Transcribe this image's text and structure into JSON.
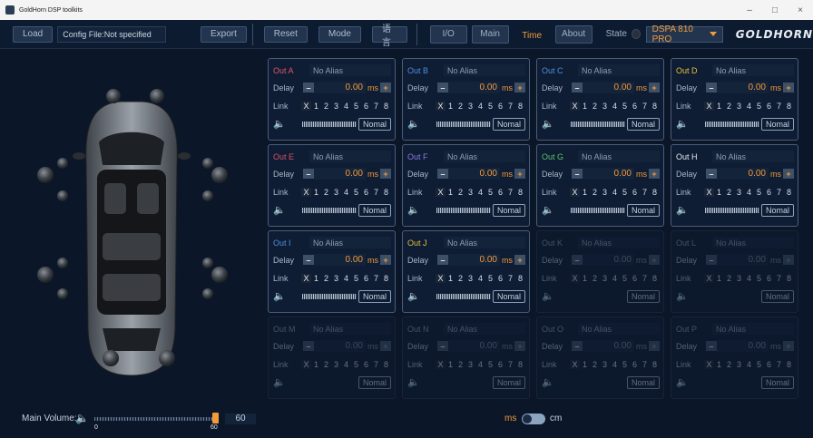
{
  "window": {
    "title": "GoldHorn DSP toolkits",
    "controls": [
      "–",
      "□",
      "×"
    ]
  },
  "toolbar": {
    "load_label": "Load",
    "config_file": "Config File:Not specified",
    "export_label": "Export",
    "reset_label": "Reset",
    "mode_label": "Mode",
    "language_label": "语言",
    "tabs": [
      {
        "label": "I/O"
      },
      {
        "label": "Main"
      },
      {
        "label": "Time",
        "active": true
      },
      {
        "label": "About"
      }
    ],
    "state_label": "State",
    "device_name": "DSPA 810 PRO",
    "logo": "GOLDHORN"
  },
  "channels": [
    {
      "name": "Out A",
      "color": "#e0556e",
      "alias": "No Alias",
      "delay": "0.00",
      "unit": "ms",
      "enabled": true
    },
    {
      "name": "Out B",
      "color": "#4f8fe0",
      "alias": "No Alias",
      "delay": "0.00",
      "unit": "ms",
      "enabled": true
    },
    {
      "name": "Out C",
      "color": "#4f8fe0",
      "alias": "No Alias",
      "delay": "0.00",
      "unit": "ms",
      "enabled": true
    },
    {
      "name": "Out D",
      "color": "#e3c13b",
      "alias": "No Alias",
      "delay": "0.00",
      "unit": "ms",
      "enabled": true
    },
    {
      "name": "Out E",
      "color": "#d6506a",
      "alias": "No Alias",
      "delay": "0.00",
      "unit": "ms",
      "enabled": true
    },
    {
      "name": "Out F",
      "color": "#8a7be0",
      "alias": "No Alias",
      "delay": "0.00",
      "unit": "ms",
      "enabled": true
    },
    {
      "name": "Out G",
      "color": "#58c46a",
      "alias": "No Alias",
      "delay": "0.00",
      "unit": "ms",
      "enabled": true
    },
    {
      "name": "Out H",
      "color": "#e6ecf3",
      "alias": "No Alias",
      "delay": "0.00",
      "unit": "ms",
      "enabled": true
    },
    {
      "name": "Out I",
      "color": "#4f8fe0",
      "alias": "No Alias",
      "delay": "0.00",
      "unit": "ms",
      "enabled": true
    },
    {
      "name": "Out J",
      "color": "#e3c13b",
      "alias": "No Alias",
      "delay": "0.00",
      "unit": "ms",
      "enabled": true
    },
    {
      "name": "Out K",
      "color": "#8a96a8",
      "alias": "No Alias",
      "delay": "0.00",
      "unit": "ms",
      "enabled": false
    },
    {
      "name": "Out L",
      "color": "#8a96a8",
      "alias": "No Alias",
      "delay": "0.00",
      "unit": "ms",
      "enabled": false
    },
    {
      "name": "Out M",
      "color": "#8a96a8",
      "alias": "No Alias",
      "delay": "0.00",
      "unit": "ms",
      "enabled": false
    },
    {
      "name": "Out N",
      "color": "#8a96a8",
      "alias": "No Alias",
      "delay": "0.00",
      "unit": "ms",
      "enabled": false
    },
    {
      "name": "Out O",
      "color": "#8a96a8",
      "alias": "No Alias",
      "delay": "0.00",
      "unit": "ms",
      "enabled": false
    },
    {
      "name": "Out P",
      "color": "#8a96a8",
      "alias": "No Alias",
      "delay": "0.00",
      "unit": "ms",
      "enabled": false
    }
  ],
  "labels": {
    "delay": "Delay",
    "link": "Link",
    "link_x": "X",
    "link_numbers": [
      "1",
      "2",
      "3",
      "4",
      "5",
      "6",
      "7",
      "8"
    ],
    "nomal": "Nomal"
  },
  "footer": {
    "main_volume_label": "Main Volume:",
    "volume_min": "0",
    "volume_max": "60",
    "volume_value": "60",
    "volume_level": 1.0,
    "unit_ms": "ms",
    "unit_cm": "cm"
  },
  "icons": {
    "app": "app-icon",
    "speaker": "speaker-icon",
    "volume": "volume-icon"
  }
}
